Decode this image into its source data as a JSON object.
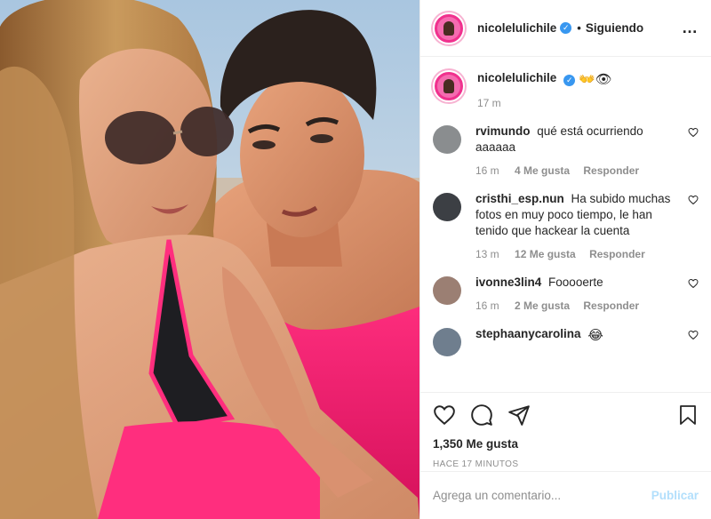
{
  "post": {
    "author": "nicolelulichile",
    "follow_status": "Siguiendo",
    "more_icon": "…",
    "verified_icon": "✓"
  },
  "caption": {
    "username": "nicolelulichile",
    "text": "👐👁",
    "time": "17 m"
  },
  "comments": [
    {
      "username": "rvimundo",
      "text": "qué está ocurriendo aaaaaa",
      "time": "16 m",
      "likes": "4 Me gusta",
      "reply": "Responder"
    },
    {
      "username": "cristhi_esp.nun",
      "text": "Ha subido muchas fotos en muy poco tiempo, le han tenido que hackear la cuenta",
      "time": "13 m",
      "likes": "12 Me gusta",
      "reply": "Responder"
    },
    {
      "username": "ivonne3lin4",
      "text": "Foooоerte",
      "time": "16 m",
      "likes": "2 Me gusta",
      "reply": "Responder"
    },
    {
      "username": "stephaanycarolina",
      "text": "😂",
      "time": "",
      "likes": "",
      "reply": ""
    }
  ],
  "actions": {
    "likes_count": "1,350 Me gusta",
    "posted_ago": "HACE 17 MINUTOS"
  },
  "add_comment": {
    "placeholder": "Agrega un comentario...",
    "publish_label": "Publicar"
  },
  "colors": {
    "text": "#262626",
    "muted": "#8e8e8e",
    "link_disabled": "#b2dffc",
    "verified": "#3897f0",
    "brand_pink": "#f0318e"
  }
}
